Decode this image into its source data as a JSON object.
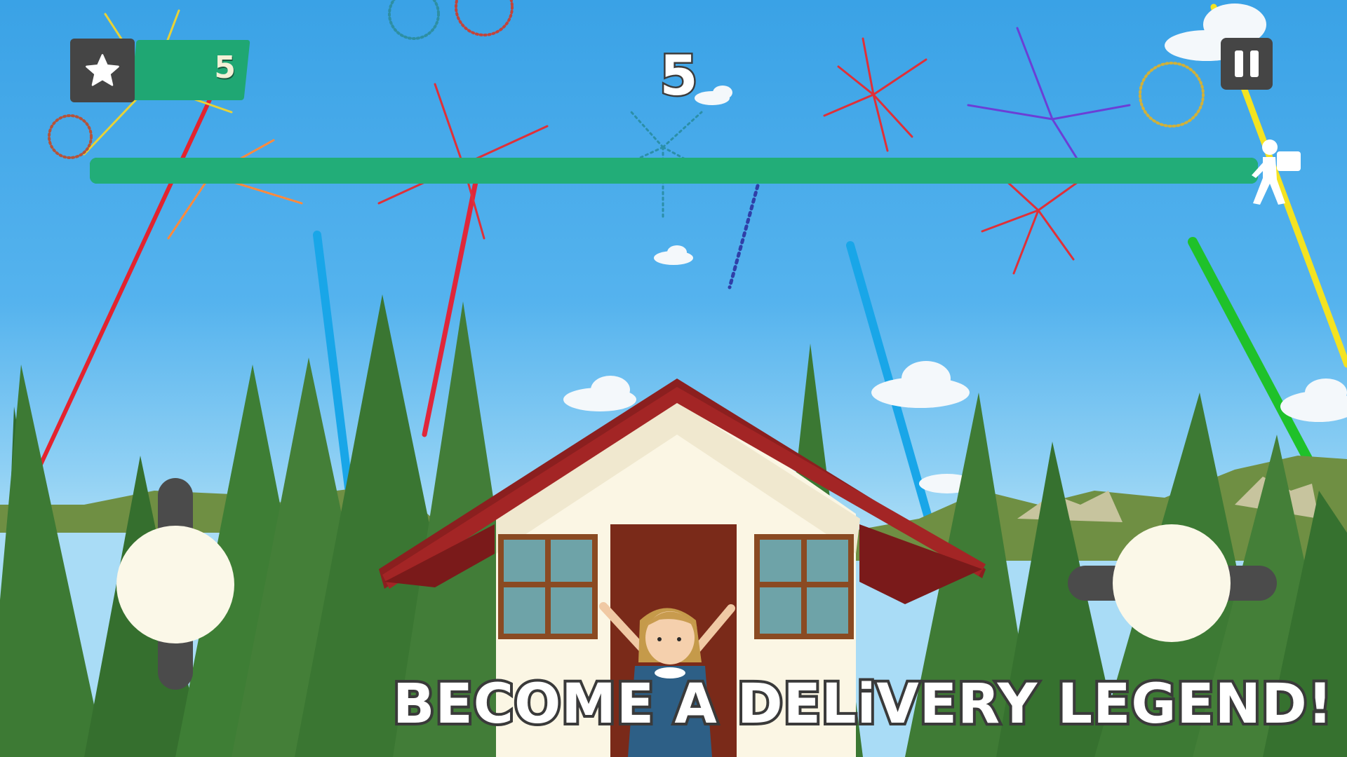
{
  "hud": {
    "coins": "5",
    "level": "5",
    "level_progress": 1.0,
    "star_icon": "star-icon",
    "pause_icon": "pause-icon",
    "runner_icon": "delivery-person-icon"
  },
  "controls": {
    "left_joystick": "vertical-joystick",
    "right_joystick": "horizontal-joystick"
  },
  "scene": {
    "setting": "house-in-pine-forest",
    "character": "waving-girl",
    "effects": "fireworks"
  },
  "colors": {
    "sky": "#4aaced",
    "accent_green": "#1fa773",
    "dark_panel": "#454545",
    "roof": "#8b1f1f",
    "wall": "#fbf6e4"
  },
  "banner": {
    "tagline": "BECOME A DELiVERY LEGEND!"
  }
}
